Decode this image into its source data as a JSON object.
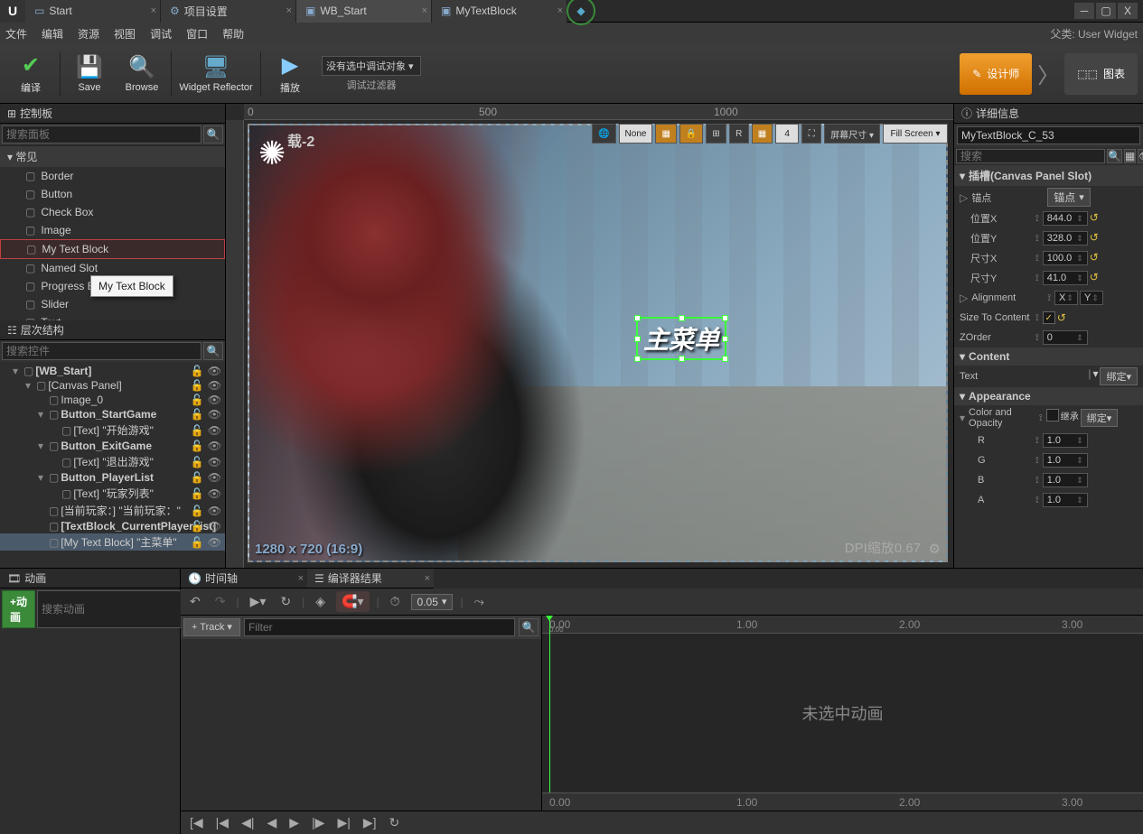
{
  "title_tabs": [
    {
      "label": "Start",
      "active": false,
      "icon": "level"
    },
    {
      "label": "项目设置",
      "active": false,
      "icon": "gear"
    },
    {
      "label": "WB_Start",
      "active": true,
      "icon": "widget-bp"
    },
    {
      "label": "MyTextBlock",
      "active": false,
      "icon": "widget-bp"
    }
  ],
  "menubar": [
    "文件",
    "编辑",
    "资源",
    "视图",
    "调试",
    "窗口",
    "帮助"
  ],
  "parent_class_label": "父类: User Widget",
  "toolbar": {
    "compile": "编译",
    "save": "Save",
    "browse": "Browse",
    "reflector": "Widget Reflector",
    "play": "播放",
    "debug_target": "没有选中调试对象 ▾",
    "debug_filter": "调试过滤器",
    "designer": "设计师",
    "graph": "图表"
  },
  "palette": {
    "title": "控制板",
    "search_ph": "搜索面板",
    "category": "常见",
    "items": [
      "Border",
      "Button",
      "Check Box",
      "Image",
      "My Text Block",
      "Named Slot",
      "Progress Bar",
      "Slider",
      "Text"
    ],
    "tooltip": "My Text Block"
  },
  "hierarchy": {
    "title": "层次结构",
    "search_ph": "搜索控件",
    "rows": [
      {
        "ind": 0,
        "label": "[WB_Start]",
        "exp": "▾",
        "bold": true
      },
      {
        "ind": 1,
        "label": "[Canvas Panel]",
        "exp": "▾"
      },
      {
        "ind": 2,
        "label": "Image_0",
        "exp": ""
      },
      {
        "ind": 2,
        "label": "Button_StartGame",
        "exp": "▾",
        "bold": true
      },
      {
        "ind": 3,
        "label": "[Text] \"开始游戏\"",
        "exp": ""
      },
      {
        "ind": 2,
        "label": "Button_ExitGame",
        "exp": "▾",
        "bold": true
      },
      {
        "ind": 3,
        "label": "[Text] \"退出游戏\"",
        "exp": ""
      },
      {
        "ind": 2,
        "label": "Button_PlayerList",
        "exp": "▾",
        "bold": true
      },
      {
        "ind": 3,
        "label": "[Text] \"玩家列表\"",
        "exp": ""
      },
      {
        "ind": 2,
        "label": "[当前玩家：] \"当前玩家：\"",
        "exp": ""
      },
      {
        "ind": 2,
        "label": "[TextBlock_CurrentPlayerList]",
        "exp": "",
        "bold": true
      },
      {
        "ind": 2,
        "label": "[My Text Block] \"主菜单\"",
        "exp": "",
        "sel": true
      }
    ]
  },
  "viewport": {
    "ruler_marks": [
      {
        "p": 0,
        "v": "0"
      },
      {
        "p": 260,
        "v": "500"
      },
      {
        "p": 520,
        "v": "1000"
      }
    ],
    "toolbar": {
      "none": "None",
      "grid": "4",
      "screen": "屏幕尺寸 ▾",
      "fill": "Fill Screen ▾"
    },
    "main_text": "主菜单",
    "res": "1280 x 720 (16:9)",
    "dpi": "DPI缩放0.67",
    "loading": "载-2"
  },
  "details": {
    "title": "详细信息",
    "name": "MyTextBlock_C_53",
    "search_ph": "搜索",
    "slot_cat": "插槽(Canvas Panel Slot)",
    "anchors": {
      "k": "锚点",
      "btn": "锚点"
    },
    "posx": {
      "k": "位置X",
      "v": "844.0"
    },
    "posy": {
      "k": "位置Y",
      "v": "328.0"
    },
    "sizex": {
      "k": "尺寸X",
      "v": "100.0"
    },
    "sizey": {
      "k": "尺寸Y",
      "v": "41.0"
    },
    "align": {
      "k": "Alignment",
      "x": "X",
      "y": "Y"
    },
    "stc": {
      "k": "Size To Content"
    },
    "zorder": {
      "k": "ZOrder",
      "v": "0"
    },
    "content_cat": "Content",
    "text": {
      "k": "Text",
      "bind": "绑定▾"
    },
    "appear_cat": "Appearance",
    "colop": {
      "k": "Color and Opacity",
      "inherit": "继承",
      "bind": "绑定▾"
    },
    "r": {
      "k": "R",
      "v": "1.0"
    },
    "g": {
      "k": "G",
      "v": "1.0"
    },
    "b": {
      "k": "B",
      "v": "1.0"
    },
    "a": {
      "k": "A",
      "v": "1.0"
    }
  },
  "anim": {
    "title": "动画",
    "add": "+动画",
    "search_ph": "搜索动画"
  },
  "timeline": {
    "tab1": "时间轴",
    "tab2": "编译器结果",
    "speed": "0.05",
    "track_btn": "+ Track ▾",
    "filter_ph": "Filter",
    "ruler": [
      {
        "p": 8,
        "v": "0.00"
      },
      {
        "p": 8,
        "v2": "0.00"
      },
      {
        "p": 215,
        "v": "1.00"
      },
      {
        "p": 395,
        "v": "2.00"
      },
      {
        "p": 575,
        "v": "3.00"
      }
    ],
    "ruler2": [
      {
        "p": 8,
        "v": "0.00"
      },
      {
        "p": 215,
        "v": "1.00"
      },
      {
        "p": 395,
        "v": "2.00"
      },
      {
        "p": 575,
        "v": "3.00"
      }
    ],
    "msg": "未选中动画"
  }
}
